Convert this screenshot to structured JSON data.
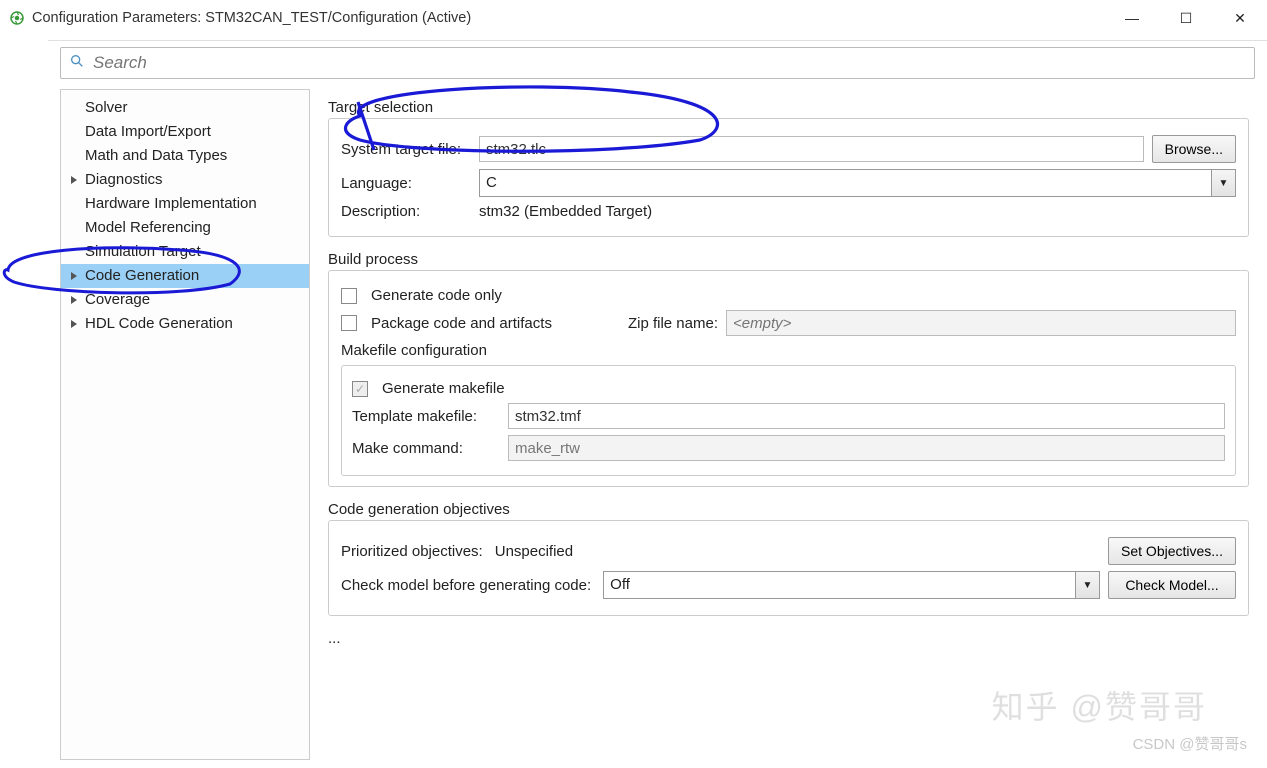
{
  "titlebar": {
    "title": "Configuration Parameters: STM32CAN_TEST/Configuration (Active)"
  },
  "search": {
    "placeholder": "Search"
  },
  "sidebar": {
    "items": [
      {
        "label": "Solver",
        "children": false,
        "selected": false
      },
      {
        "label": "Data Import/Export",
        "children": false,
        "selected": false
      },
      {
        "label": "Math and Data Types",
        "children": false,
        "selected": false
      },
      {
        "label": "Diagnostics",
        "children": true,
        "selected": false
      },
      {
        "label": "Hardware Implementation",
        "children": false,
        "selected": false
      },
      {
        "label": "Model Referencing",
        "children": false,
        "selected": false
      },
      {
        "label": "Simulation Target",
        "children": false,
        "selected": false
      },
      {
        "label": "Code Generation",
        "children": true,
        "selected": true
      },
      {
        "label": "Coverage",
        "children": true,
        "selected": false
      },
      {
        "label": "HDL Code Generation",
        "children": true,
        "selected": false
      }
    ]
  },
  "target": {
    "section": "Target selection",
    "sys_label": "System target file:",
    "sys_value": "stm32.tlc",
    "browse": "Browse...",
    "lang_label": "Language:",
    "lang_value": "C",
    "desc_label": "Description:",
    "desc_value": "stm32 (Embedded Target)"
  },
  "build": {
    "section": "Build process",
    "gen_code_only": "Generate code only",
    "pkg_code": "Package code and artifacts",
    "zip_label": "Zip file name:",
    "zip_placeholder": "<empty>",
    "mk_section": "Makefile configuration",
    "gen_mk": "Generate makefile",
    "tmpl_label": "Template makefile:",
    "tmpl_value": "stm32.tmf",
    "cmd_label": "Make command:",
    "cmd_value": "make_rtw"
  },
  "obj": {
    "section": "Code generation objectives",
    "prio_label": "Prioritized objectives:",
    "prio_value": "Unspecified",
    "set_btn": "Set Objectives...",
    "check_label": "Check model before generating code:",
    "check_value": "Off",
    "check_btn": "Check Model..."
  },
  "more": "...",
  "watermark": {
    "w1": "知乎 @赞哥哥",
    "w2": "CSDN @赞哥哥s"
  }
}
